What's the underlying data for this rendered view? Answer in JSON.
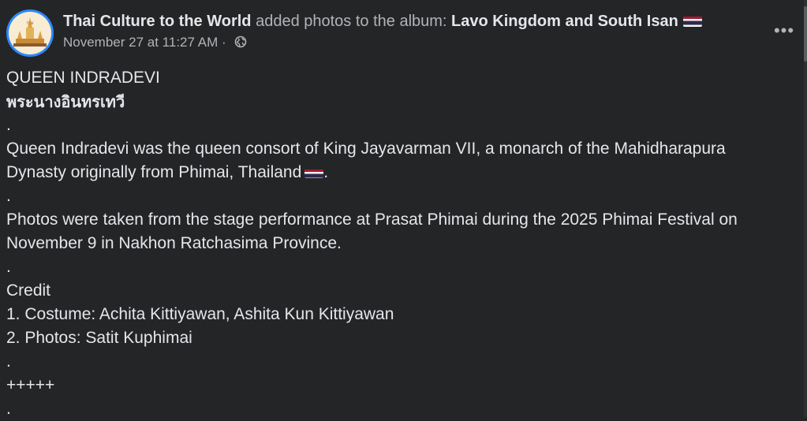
{
  "header": {
    "page_name": "Thai Culture to the World",
    "action_text": " added photos to the album: ",
    "album_name": "Lavo Kingdom and South Isan",
    "timestamp": "November 27 at 11:27 AM",
    "separator": " · ",
    "privacy_icon": "globe-icon",
    "more_label": "•••"
  },
  "post": {
    "lines": [
      "QUEEN INDRADEVI",
      "พระนางอินทรเทวี",
      ".",
      "Queen Indradevi was the queen consort of King Jayavarman VII, a monarch of the Mahidharapura",
      "Dynasty originally from Phimai, Thailand",
      ".",
      "Photos were taken from the stage performance at Prasat Phimai during the 2025 Phimai Festival on",
      "November 9 in Nakhon Ratchasima Province.",
      ".",
      "Credit",
      "1. Costume: Achita Kittiyawan, Ashita Kun Kittiyawan",
      "2. Photos: Satit Kuphimai",
      ".",
      "+++++",
      "."
    ],
    "line5_suffix": "."
  },
  "colors": {
    "background": "#242526",
    "text_primary": "#e4e6eb",
    "text_secondary": "#b0b3b8",
    "avatar_ring": "#2d88ff",
    "flag_red": "#a51931",
    "flag_white": "#f4f5f8",
    "flag_blue": "#2d2a4a"
  }
}
